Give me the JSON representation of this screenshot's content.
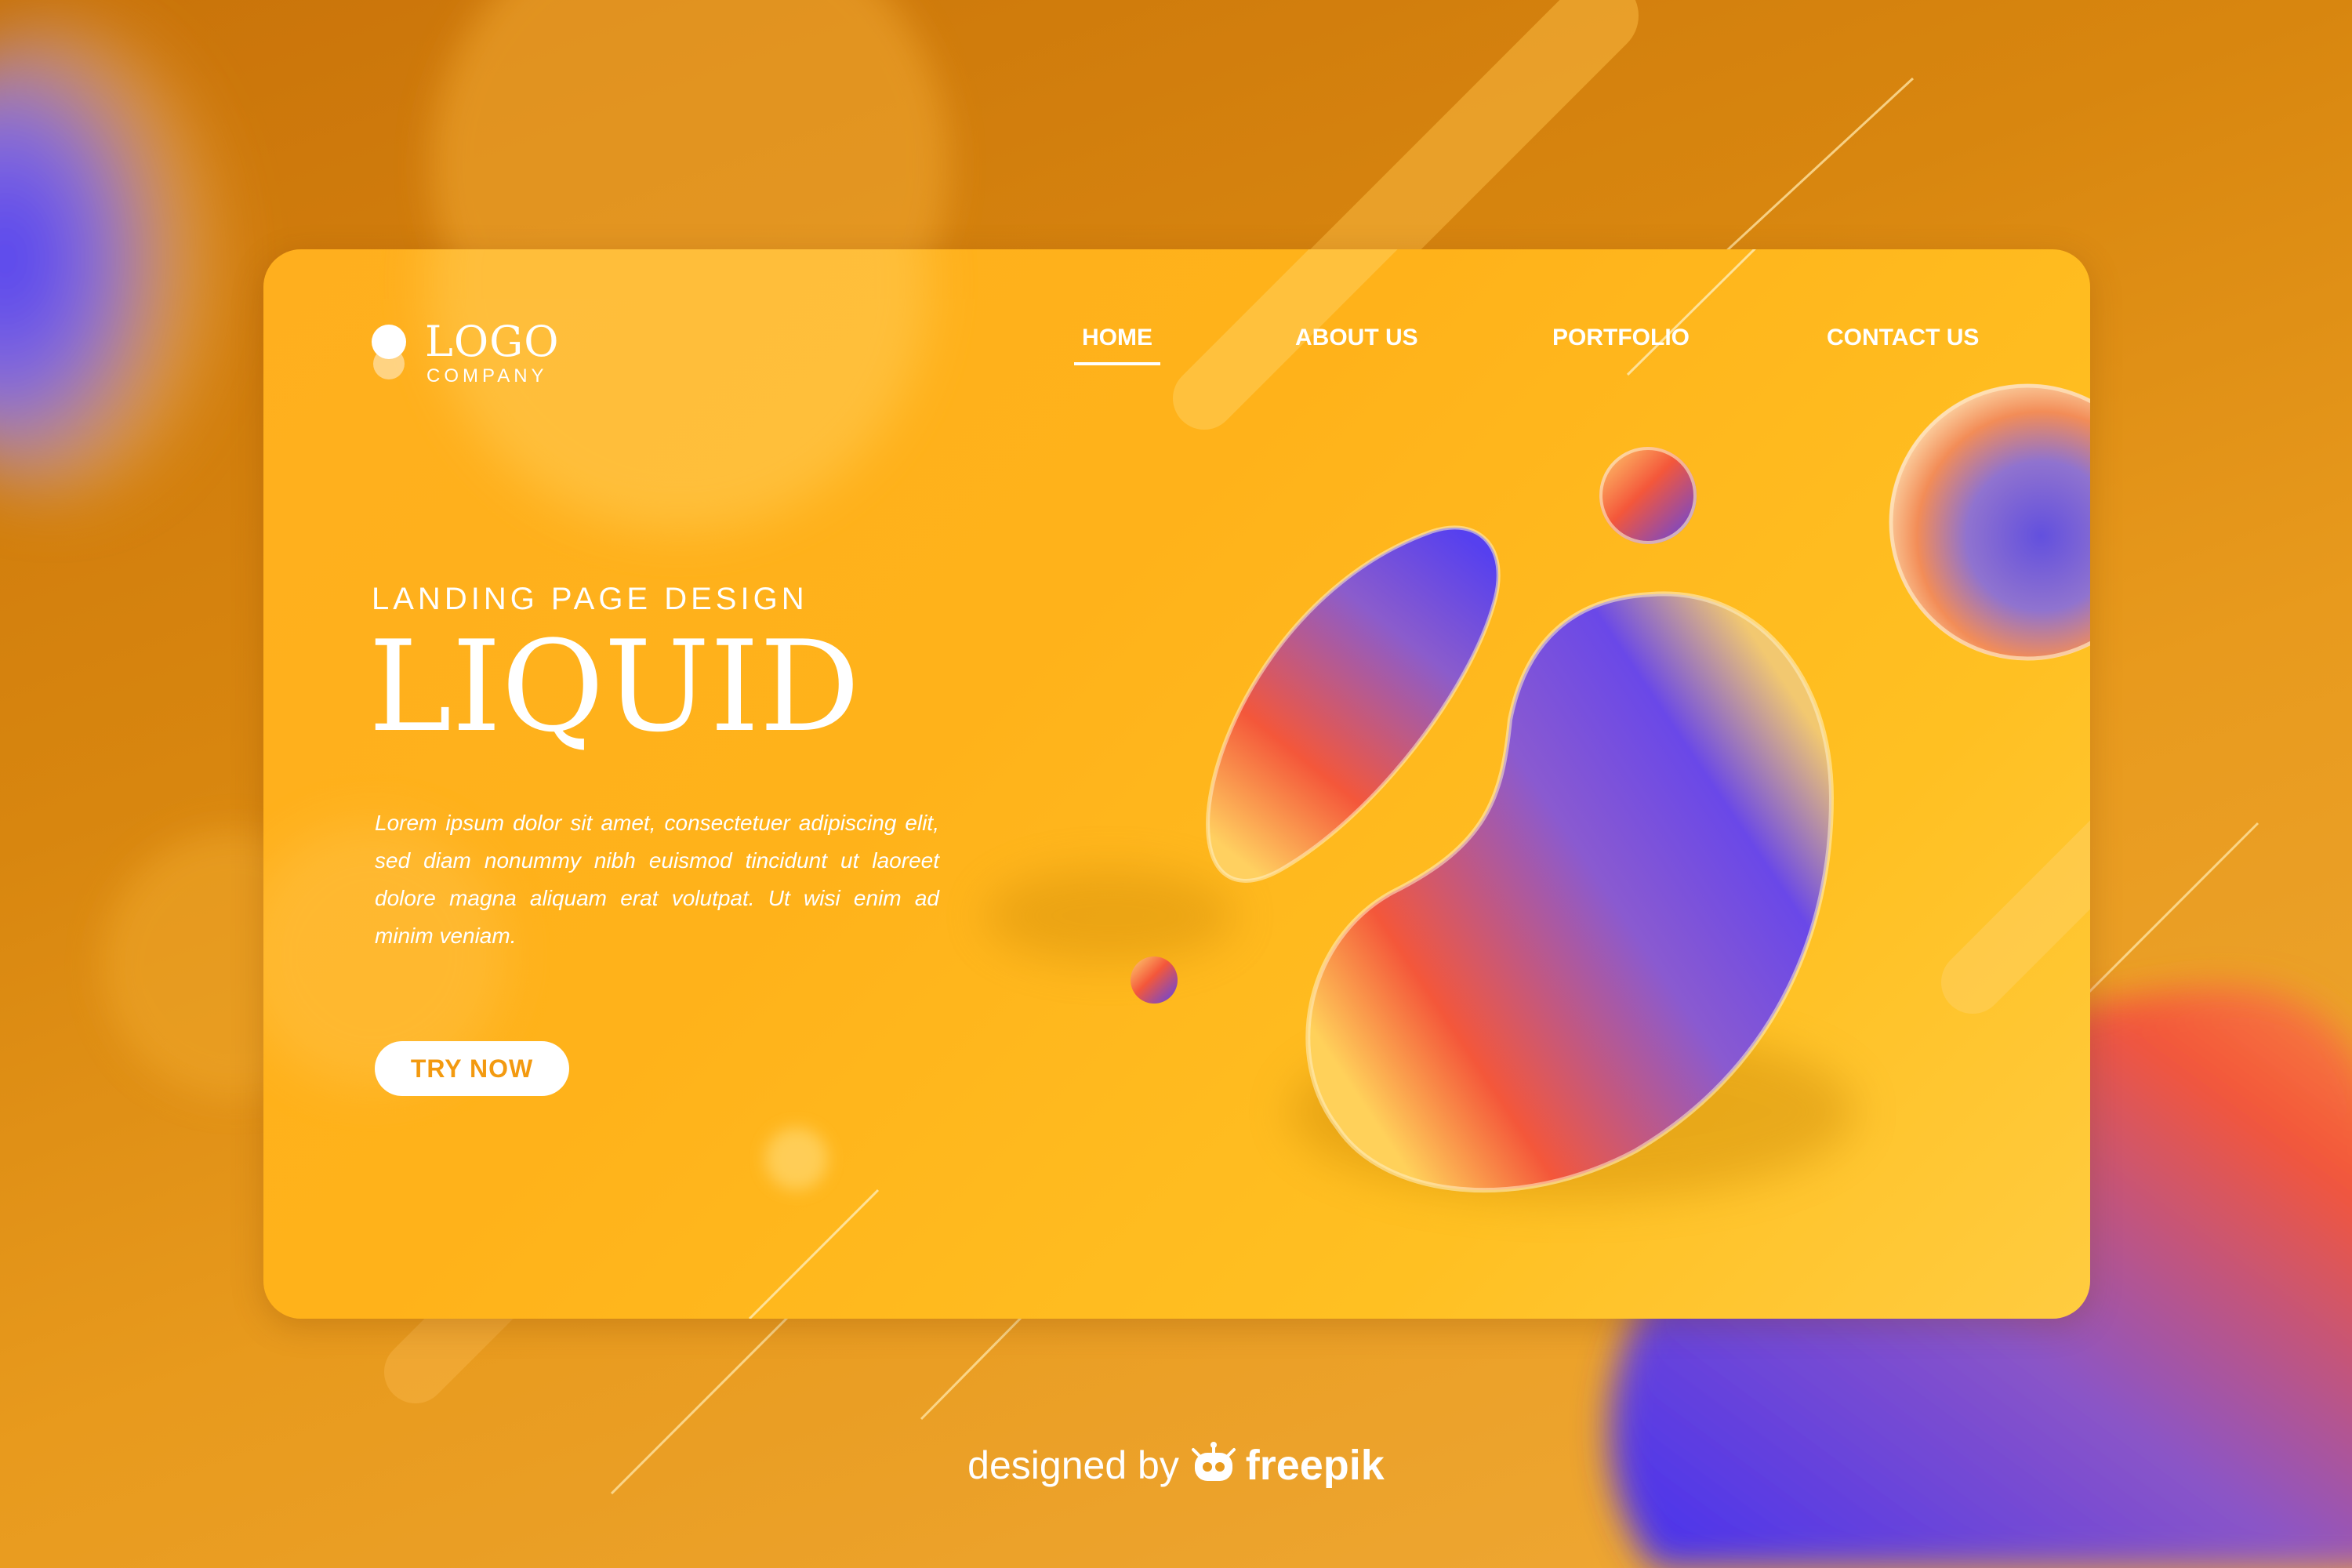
{
  "logo": {
    "title": "LOGO",
    "subtitle": "COMPANY"
  },
  "nav": {
    "items": [
      {
        "label": "HOME",
        "active": true
      },
      {
        "label": "ABOUT US",
        "active": false
      },
      {
        "label": "PORTFOLIO",
        "active": false
      },
      {
        "label": "CONTACT US",
        "active": false
      }
    ]
  },
  "hero": {
    "eyebrow": "LANDING PAGE DESIGN",
    "title": "LIQUID",
    "body": "Lorem ipsum dolor sit amet, consectetuer adipiscing elit, sed diam nonummy nibh euismod tincidunt ut laoreet dolore magna aliquam erat volutpat. Ut wisi enim ad minim veniam.",
    "cta_label": "TRY NOW"
  },
  "credit": {
    "prefix": "designed by",
    "brand": "freepik"
  },
  "colors": {
    "background": "#d8860f",
    "card": "#ffb21a",
    "accent": "#f39a10",
    "blob_purple": "#5a3cf0",
    "blob_red": "#f4563a",
    "text": "#ffffff"
  },
  "icons": {
    "logo_mark": "logo-dots-icon",
    "freepik_mark": "freepik-robot-icon"
  }
}
